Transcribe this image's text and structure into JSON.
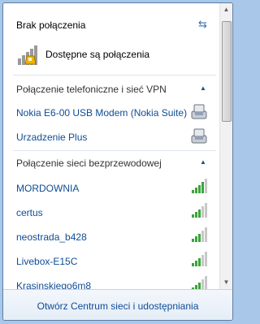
{
  "status": {
    "title": "Brak połączenia",
    "available": "Dostępne są połączenia"
  },
  "sections": [
    {
      "label": "Połączenie telefoniczne i sieć VPN",
      "items": [
        {
          "label": "Nokia E6-00 USB Modem (Nokia Suite)",
          "icon": "modem-icon"
        },
        {
          "label": "Urzadzenie Plus",
          "icon": "modem-icon"
        }
      ]
    },
    {
      "label": "Połączenie sieci bezprzewodowej",
      "items": [
        {
          "label": "MORDOWNIA",
          "icon": "wifi-signal-icon"
        },
        {
          "label": "certus",
          "icon": "wifi-signal-icon"
        },
        {
          "label": "neostrada_b428",
          "icon": "wifi-signal-icon"
        },
        {
          "label": "Livebox-E15C",
          "icon": "wifi-signal-icon"
        },
        {
          "label": "Krasinskiego6m8",
          "icon": "wifi-signal-icon"
        }
      ]
    }
  ],
  "footer": {
    "link": "Otwórz Centrum sieci i udostępniania"
  },
  "colors": {
    "link": "#0f4c96",
    "signal_active": "#3aa53a",
    "signal_inactive": "#c8c8c8",
    "warning": "#f2b300"
  }
}
